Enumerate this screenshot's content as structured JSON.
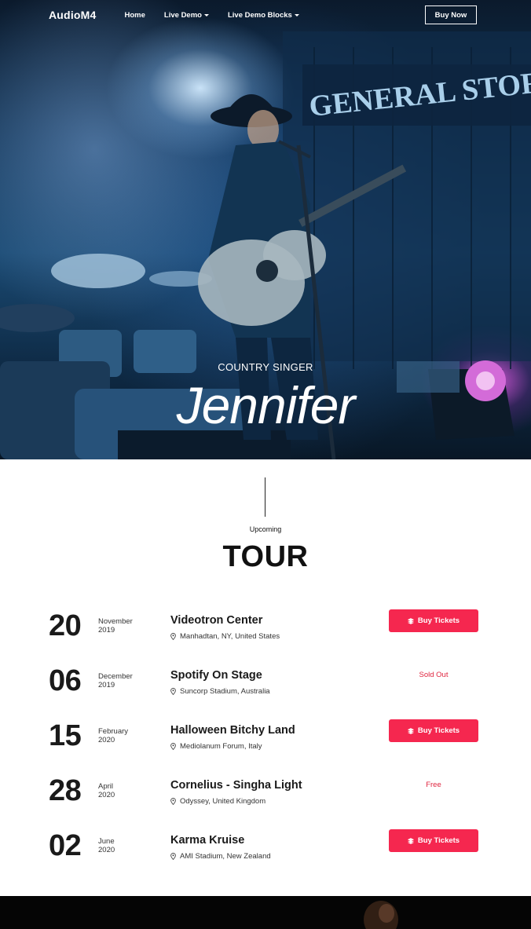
{
  "nav": {
    "logo": "AudioM4",
    "items": [
      {
        "label": "Home",
        "has_caret": false
      },
      {
        "label": "Live Demo",
        "has_caret": true
      },
      {
        "label": "Live Demo Blocks",
        "has_caret": true
      }
    ],
    "buy_now": "Buy Now"
  },
  "hero": {
    "subtitle": "COUNTRY SINGER",
    "title": "Jennifer",
    "sign_text": "GENERAL STOR"
  },
  "tour": {
    "eyebrow": "Upcoming",
    "title": "TOUR",
    "events": [
      {
        "day": "20",
        "month": "November",
        "year": "2019",
        "venue": "Videotron Center",
        "location": "Manhadtan, NY, United States",
        "action": "Buy Tickets",
        "action_type": "button"
      },
      {
        "day": "06",
        "month": "December",
        "year": "2019",
        "venue": "Spotify On Stage",
        "location": "Suncorp Stadium, Australia",
        "action": "Sold Out",
        "action_type": "status"
      },
      {
        "day": "15",
        "month": "February",
        "year": "2020",
        "venue": "Halloween Bitchy Land",
        "location": "Mediolanum Forum, Italy",
        "action": "Buy Tickets",
        "action_type": "button"
      },
      {
        "day": "28",
        "month": "April",
        "year": "2020",
        "venue": "Cornelius - Singha Light",
        "location": "Odyssey, United Kingdom",
        "action": "Free",
        "action_type": "status"
      },
      {
        "day": "02",
        "month": "June",
        "year": "2020",
        "venue": "Karma Kruise",
        "location": "AMI Stadium, New Zealand",
        "action": "Buy Tickets",
        "action_type": "button"
      }
    ]
  },
  "colors": {
    "accent": "#f5274f",
    "status_text": "#e0253f",
    "hero_blue": "#1a4a73"
  },
  "icons": {
    "location": "map-pin-icon",
    "ticket": "ticket-icon",
    "dropdown": "chevron-down-icon"
  }
}
